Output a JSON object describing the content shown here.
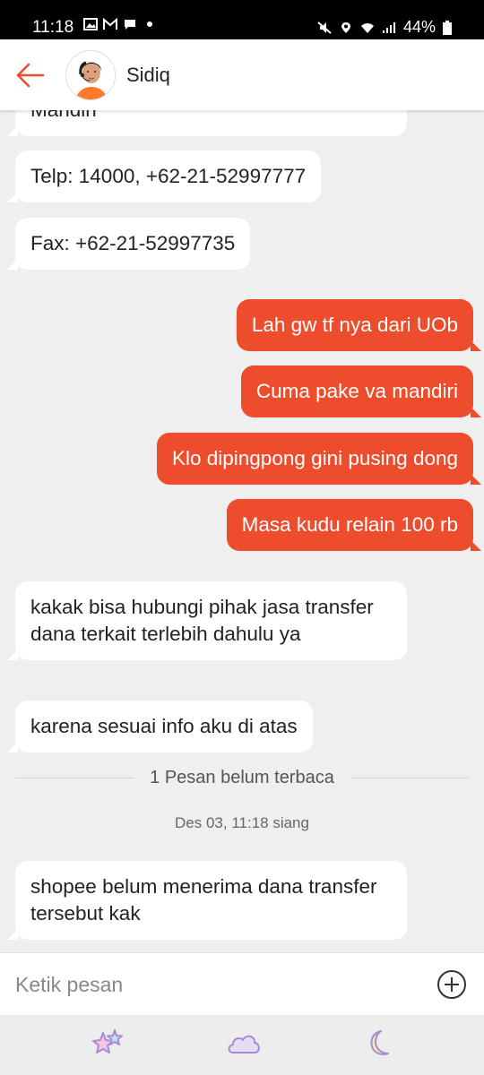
{
  "status_bar": {
    "time": "11:18",
    "battery": "44%"
  },
  "header": {
    "contact_name": "Sidiq"
  },
  "messages": [
    {
      "side": "in",
      "text": "Mandiri"
    },
    {
      "side": "in",
      "text": "Telp: 14000, +62-21-52997777"
    },
    {
      "side": "in",
      "text": "Fax: +62-21-52997735"
    },
    {
      "side": "out",
      "text": "Lah gw tf nya dari UOb"
    },
    {
      "side": "out",
      "text": "Cuma pake va mandiri"
    },
    {
      "side": "out",
      "text": "Klo dipingpong gini pusing dong"
    },
    {
      "side": "out",
      "text": "Masa kudu relain 100 rb"
    },
    {
      "side": "in",
      "text": "kakak bisa hubungi pihak jasa transfer dana terkait terlebih dahulu ya"
    },
    {
      "side": "in",
      "text": "karena sesuai info aku di atas"
    },
    {
      "side": "in",
      "text": "shopee belum menerima dana transfer tersebut kak"
    }
  ],
  "unread_divider": "1 Pesan belum terbaca",
  "timestamp": "Des 03, 11:18 siang",
  "input": {
    "placeholder": "Ketik pesan"
  },
  "colors": {
    "accent": "#ee4d2d",
    "sticker": "#a78bd4"
  },
  "icons": [
    "back-arrow-icon",
    "add-circle-icon",
    "star-sticker-icon",
    "cloud-sticker-icon",
    "moon-sticker-icon"
  ]
}
